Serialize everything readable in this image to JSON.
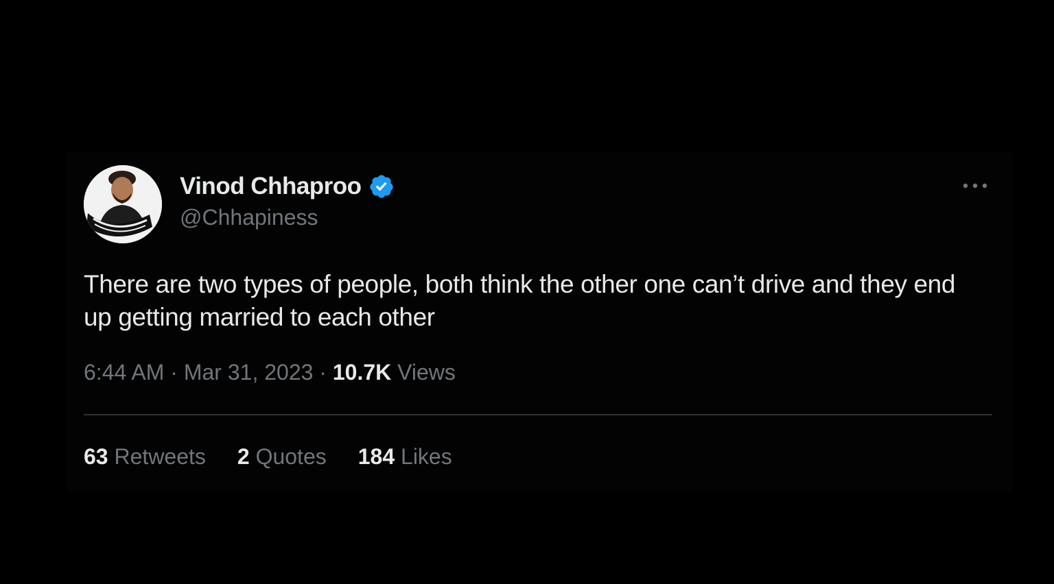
{
  "author": {
    "display_name": "Vinod Chhaproo",
    "handle": "@Chhapiness",
    "verified": true,
    "avatar_icon": "profile-photo-avatar",
    "badge_color": "#1d9bf0"
  },
  "menu_icon": "more-horizontal-icon",
  "tweet": {
    "text": "There are two types of people, both think the other one can’t drive and they end up getting married to each other",
    "time": "6:44 AM",
    "separator": " · ",
    "date": "Mar 31, 2023",
    "views_count": "10.7K",
    "views_label": " Views"
  },
  "stats": {
    "retweets_count": "63",
    "retweets_label": " Retweets",
    "quotes_count": "2",
    "quotes_label": " Quotes",
    "likes_count": "184",
    "likes_label": " Likes"
  },
  "colors": {
    "background": "#000000",
    "primary_text": "#e7e9ea",
    "secondary_text": "#71767b",
    "divider": "#2f3336"
  }
}
